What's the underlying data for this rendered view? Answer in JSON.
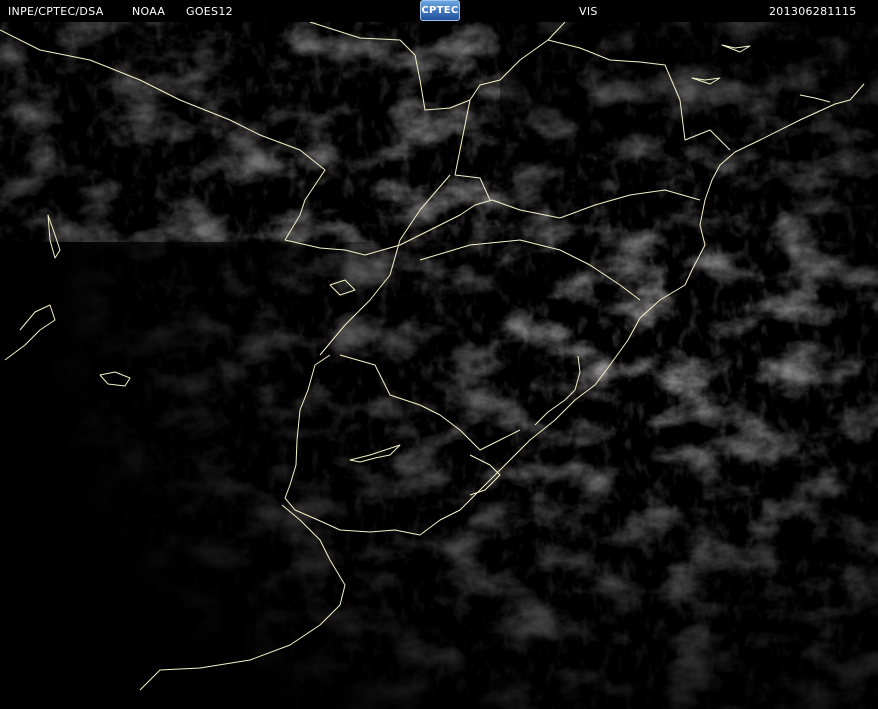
{
  "header": {
    "source": "INPE/CPTEC/DSA",
    "agency": "NOAA",
    "satellite": "GOES12",
    "logo_text": "CPTEC",
    "channel": "VIS",
    "timestamp": "201306281115"
  },
  "colors": {
    "background": "#000000",
    "header_text": "#ffffff",
    "boundary": "#f4f2c8",
    "cloud": "#bfbfbf"
  }
}
